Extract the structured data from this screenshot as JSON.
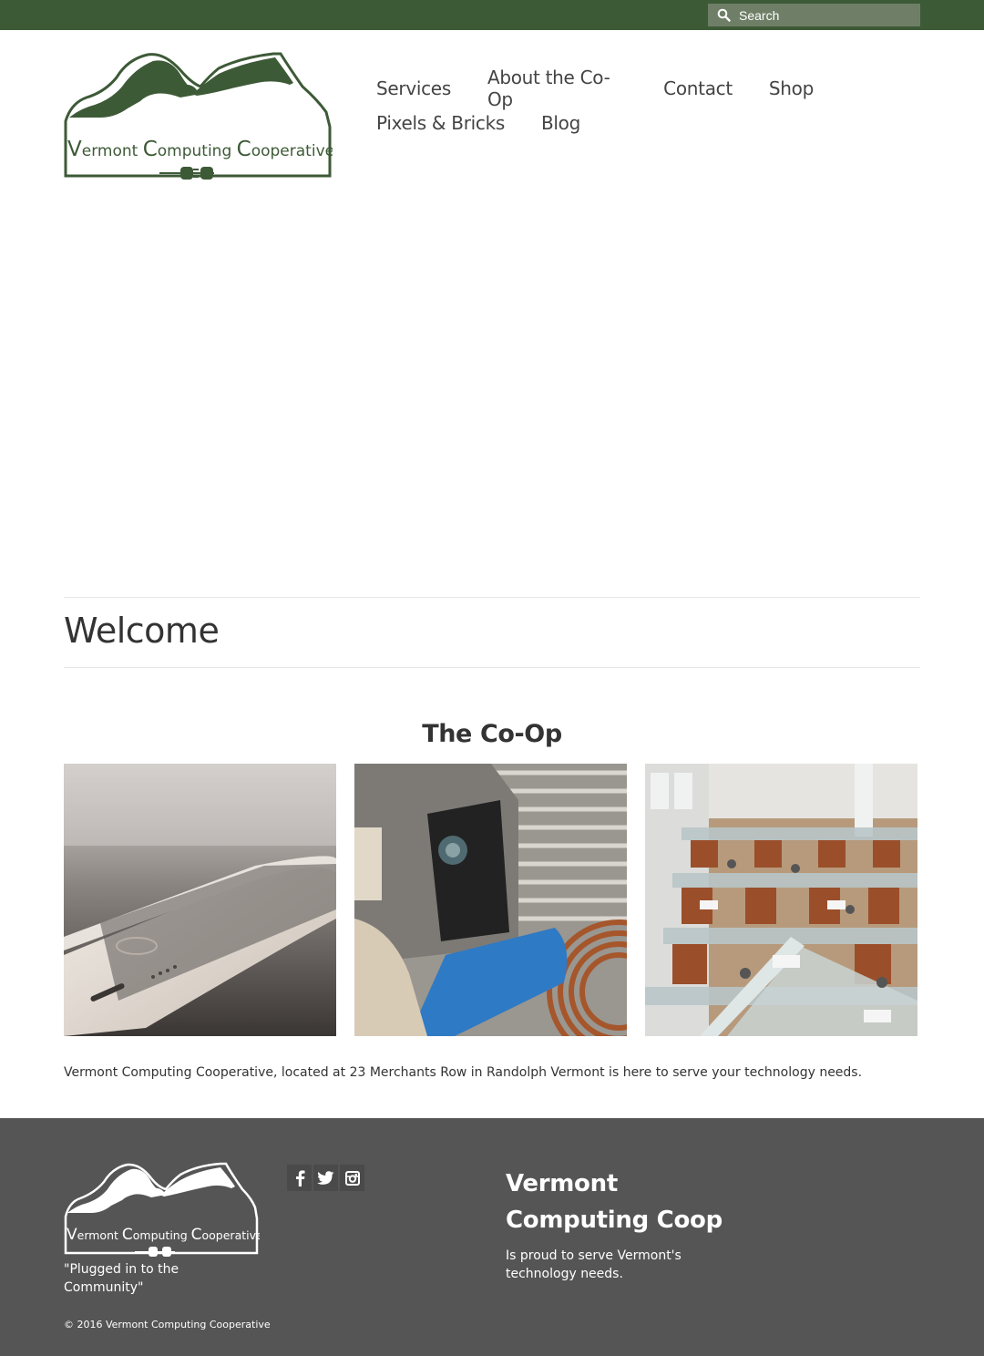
{
  "search": {
    "placeholder": "Search",
    "icon": "search-icon"
  },
  "logo": {
    "text_parts": [
      "V",
      "ermont ",
      "C",
      "omputing ",
      "C",
      "ooperative"
    ],
    "color": "#3d5a37"
  },
  "nav": {
    "items": [
      {
        "label": "Services"
      },
      {
        "label": "About the Co-Op"
      },
      {
        "label": "Contact"
      },
      {
        "label": "Shop"
      },
      {
        "label": "Pixels & Bricks"
      },
      {
        "label": "Blog"
      }
    ]
  },
  "main": {
    "heading": "Welcome",
    "section_title": "The Co-Op",
    "photos": [
      "smartphone-photo",
      "electronics-heatsink-photo",
      "office-cubicles-photo"
    ],
    "description": "Vermont Computing Cooperative, located at 23 Merchants Row in Randolph Vermont is here to serve your technology needs."
  },
  "footer": {
    "tagline": "\"Plugged in to the Community\"",
    "copyright": "© 2016 Vermont Computing Cooperative",
    "social": [
      {
        "icon": "facebook-icon",
        "glyph": "f"
      },
      {
        "icon": "twitter-icon",
        "glyph": "t"
      },
      {
        "icon": "instagram-icon",
        "glyph": "i"
      }
    ],
    "title": "Vermont Computing Coop",
    "text": "Is proud to serve Vermont's technology needs."
  },
  "colors": {
    "brand_green": "#3d5a37",
    "search_bg": "#6f7f67",
    "footer_bg": "#555555"
  }
}
